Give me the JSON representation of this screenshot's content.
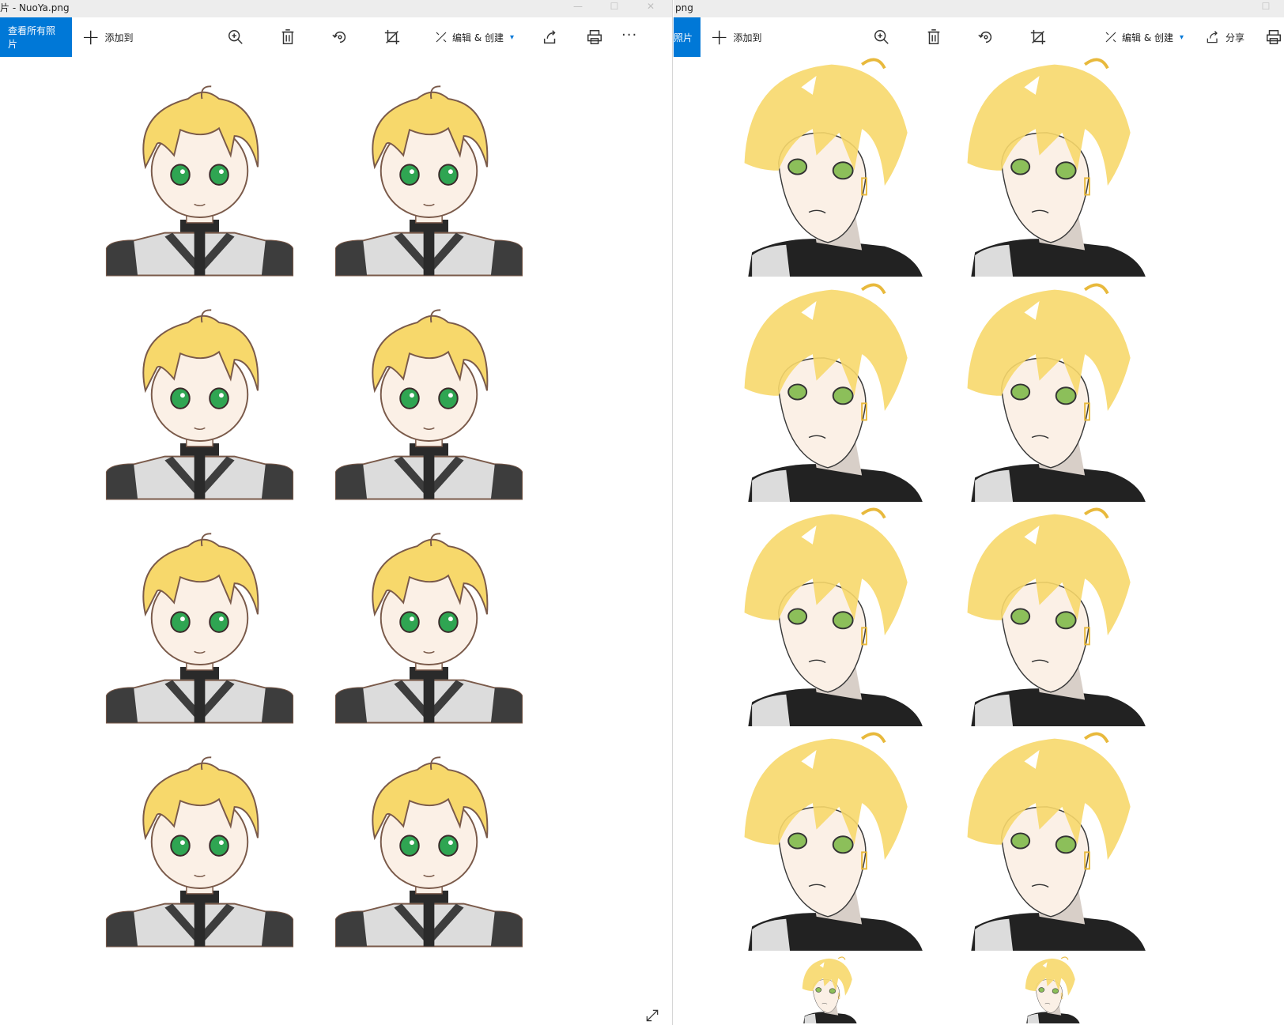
{
  "left_window": {
    "title": "片 - NuoYa.png",
    "toolbar": {
      "view_all": "查看所有照片",
      "add_to": "添加到",
      "edit_create": "编辑 & 创建",
      "more": "···"
    }
  },
  "right_window": {
    "title": "png",
    "toolbar": {
      "view_all": "照片",
      "add_to": "添加到",
      "edit_create": "编辑 & 创建",
      "share": "分享"
    }
  },
  "icons": {
    "zoom": "zoom-in-icon",
    "delete": "trash-icon",
    "rotate": "rotate-icon",
    "crop": "crop-icon",
    "edit": "edit-create-icon",
    "share": "share-icon",
    "print": "print-icon",
    "expand": "expand-icon"
  },
  "colors": {
    "accent": "#0078d7",
    "hair": "#f7d86b",
    "hair_shadow": "#e8b93c",
    "eyes_left": "#2fa552",
    "eyes_right": "#8cbf5a",
    "skin": "#fbf0e6",
    "clothing_dark": "#3d3d3d",
    "clothing_light": "#dcdcdc"
  }
}
